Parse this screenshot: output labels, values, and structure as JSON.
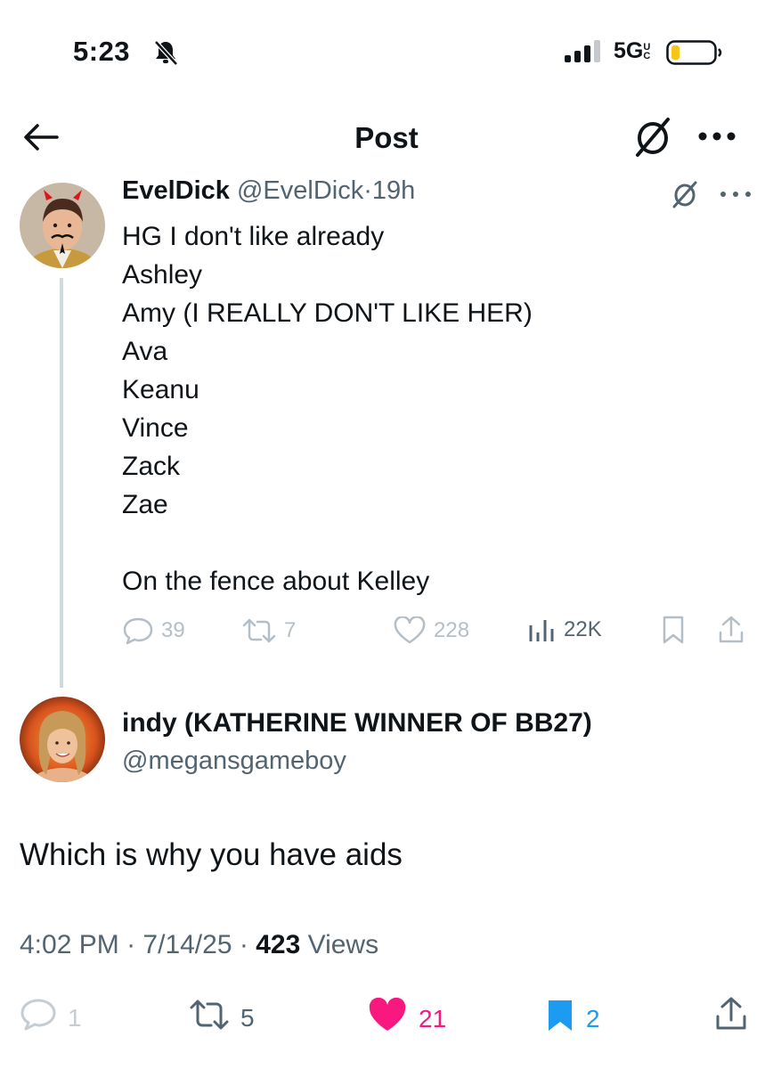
{
  "status_bar": {
    "time": "5:23",
    "network": "5G",
    "network_suffix": "UC"
  },
  "header": {
    "title": "Post"
  },
  "parent_tweet": {
    "display_name": "EvelDick",
    "handle": "@EvelDick",
    "separator": "·",
    "time": "19h",
    "lines": [
      "HG I don't like already",
      "Ashley",
      "Amy (I REALLY DON'T LIKE HER)",
      "Ava",
      "Keanu",
      "Vince",
      "Zack",
      "Zae",
      "",
      "On the fence about Kelley"
    ],
    "replies": "39",
    "reposts": "7",
    "likes": "228",
    "views": "22K"
  },
  "reply_tweet": {
    "display_name": "indy (KATHERINE WINNER OF BB27)",
    "handle": "@megansgameboy",
    "text": "Which is why you have aids",
    "time": "4:02 PM",
    "sep1": "·",
    "date": "7/14/25",
    "sep2": "·",
    "views_count": "423",
    "views_label": "Views",
    "replies": "1",
    "reposts": "5",
    "likes": "21",
    "bookmarks": "2"
  },
  "colors": {
    "like_active": "#f91880",
    "bookmark_active": "#1d9bf0",
    "muted_text": "#536471",
    "faded_icon": "#b4bec7"
  },
  "icons": [
    "bell-slash-icon",
    "signal-icon",
    "battery-icon",
    "back-arrow-icon",
    "null-symbol-icon",
    "more-icon",
    "reply-icon",
    "repost-icon",
    "like-icon",
    "views-icon",
    "bookmark-icon",
    "share-icon"
  ]
}
